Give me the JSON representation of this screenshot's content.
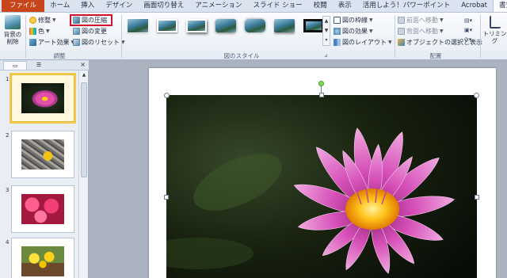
{
  "tabs": [
    "ファイル",
    "ホーム",
    "挿入",
    "デザイン",
    "画面切り替え",
    "アニメーション",
    "スライド ショー",
    "校閲",
    "表示",
    "活用しよう！パワーポイント",
    "Acrobat",
    "書式"
  ],
  "active_tab": "書式",
  "ribbon": {
    "remove_bg_label_1": "背景の",
    "remove_bg_label_2": "削除",
    "corrections": "修整",
    "color": "色",
    "artistic_effects": "アート効果",
    "compress": "図の圧縮",
    "change_picture": "図の変更",
    "reset_picture": "図のリセット",
    "adjust_group": "調整",
    "picture_styles_group": "図のスタイル",
    "picture_border": "図の枠線",
    "picture_effects": "図の効果",
    "picture_layout": "図のレイアウト",
    "bring_forward": "前面へ移動",
    "send_backward": "背面へ移動",
    "selection_pane": "オブジェクトの選択と表示",
    "arrange_group": "配置",
    "crop": "トリミング"
  },
  "slides": [
    {
      "num": "1",
      "subject": "pink water lily"
    },
    {
      "num": "2",
      "subject": "yellow flower on stones"
    },
    {
      "num": "3",
      "subject": "pink azaleas"
    },
    {
      "num": "4",
      "subject": "yellow flowers basket"
    }
  ],
  "colors": {
    "file_tab": "#c8451c",
    "highlight": "#d0102a",
    "selection": "#f2c94c"
  }
}
